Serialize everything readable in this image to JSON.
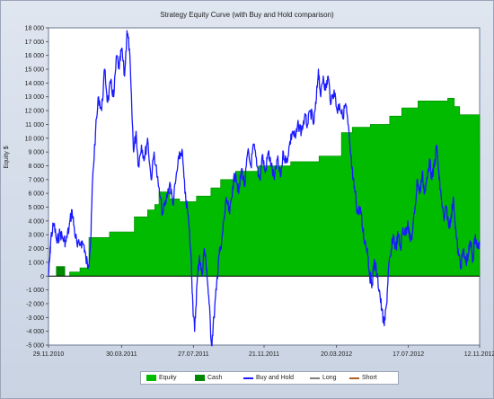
{
  "chart_data": {
    "type": "area",
    "title": "Strategy Equity Curve (with Buy and Hold comparison)",
    "ylabel": "Equity $",
    "ylim": [
      -5000,
      18000
    ],
    "yticks": [
      18000,
      17000,
      16000,
      15000,
      14000,
      13000,
      12000,
      11000,
      10000,
      9000,
      8000,
      7000,
      6000,
      5000,
      4000,
      3000,
      2000,
      1000,
      0,
      -1000,
      -2000,
      -3000,
      -4000,
      -5000
    ],
    "ytick_labels": [
      "18 000",
      "17 000",
      "16 000",
      "15 000",
      "14 000",
      "13 000",
      "12 000",
      "11 000",
      "10 000",
      "9 000",
      "8 000",
      "7 000",
      "6 000",
      "5 000",
      "4 000",
      "3 000",
      "2 000",
      "1 000",
      "0",
      "-1 000",
      "-2 000",
      "-3 000",
      "-4 000",
      "-5 000"
    ],
    "xlim": [
      "2010-11-29",
      "2012-11-12"
    ],
    "xticks": [
      "2010-11-29",
      "2011-03-30",
      "2011-07-27",
      "2011-11-21",
      "2012-03-20",
      "2012-07-17",
      "2012-11-12"
    ],
    "xtick_labels": [
      "29.11.2010",
      "30.03.2011",
      "27.07.2011",
      "21.11.2011",
      "20.03.2012",
      "17.07.2012",
      "12.11.2012"
    ],
    "grid": false,
    "legend_position": "bottom",
    "colors": {
      "equity": "#00bb00",
      "cash": "#008800",
      "buy_and_hold": "#1a1aff",
      "long": "#808080",
      "short": "#b06020",
      "zero_line": "#000000"
    },
    "series": [
      {
        "name": "Equity",
        "style": "step-area",
        "points": [
          [
            "2010-11-29",
            0
          ],
          [
            "2010-12-12",
            0
          ],
          [
            "2010-12-12",
            700
          ],
          [
            "2010-12-26",
            700
          ],
          [
            "2010-12-26",
            0
          ],
          [
            "2011-01-03",
            0
          ],
          [
            "2011-01-03",
            300
          ],
          [
            "2011-01-20",
            300
          ],
          [
            "2011-01-20",
            600
          ],
          [
            "2011-02-04",
            600
          ],
          [
            "2011-02-04",
            2800
          ],
          [
            "2011-03-10",
            2800
          ],
          [
            "2011-03-10",
            3200
          ],
          [
            "2011-04-20",
            3200
          ],
          [
            "2011-04-20",
            4300
          ],
          [
            "2011-05-12",
            4300
          ],
          [
            "2011-05-12",
            4800
          ],
          [
            "2011-05-24",
            4800
          ],
          [
            "2011-05-24",
            5200
          ],
          [
            "2011-05-31",
            5200
          ],
          [
            "2011-05-31",
            6100
          ],
          [
            "2011-06-18",
            6100
          ],
          [
            "2011-06-18",
            5600
          ],
          [
            "2011-07-04",
            5600
          ],
          [
            "2011-07-04",
            5400
          ],
          [
            "2011-08-01",
            5400
          ],
          [
            "2011-08-01",
            5800
          ],
          [
            "2011-08-25",
            5800
          ],
          [
            "2011-08-25",
            6400
          ],
          [
            "2011-09-10",
            6400
          ],
          [
            "2011-09-10",
            7000
          ],
          [
            "2011-10-05",
            7000
          ],
          [
            "2011-10-05",
            7600
          ],
          [
            "2011-11-12",
            7600
          ],
          [
            "2011-11-12",
            8000
          ],
          [
            "2012-01-04",
            8000
          ],
          [
            "2012-01-04",
            8300
          ],
          [
            "2012-02-20",
            8300
          ],
          [
            "2012-02-20",
            8700
          ],
          [
            "2012-03-28",
            8700
          ],
          [
            "2012-03-28",
            10400
          ],
          [
            "2012-04-15",
            10400
          ],
          [
            "2012-04-15",
            10800
          ],
          [
            "2012-05-15",
            10800
          ],
          [
            "2012-05-15",
            11000
          ],
          [
            "2012-06-16",
            11000
          ],
          [
            "2012-06-16",
            11600
          ],
          [
            "2012-07-06",
            11600
          ],
          [
            "2012-07-06",
            12200
          ],
          [
            "2012-08-02",
            12200
          ],
          [
            "2012-08-02",
            12700
          ],
          [
            "2012-09-20",
            12700
          ],
          [
            "2012-09-20",
            12900
          ],
          [
            "2012-10-01",
            12900
          ],
          [
            "2012-10-01",
            12300
          ],
          [
            "2012-10-10",
            12300
          ],
          [
            "2012-10-10",
            11700
          ],
          [
            "2012-11-12",
            11700
          ]
        ]
      },
      {
        "name": "Cash",
        "style": "step-area",
        "points": [
          [
            "2010-12-12",
            700
          ],
          [
            "2010-12-26",
            700
          ]
        ]
      },
      {
        "name": "Buy and Hold",
        "style": "line",
        "points": [
          [
            "2010-11-29",
            0
          ],
          [
            "2010-12-01",
            1200
          ],
          [
            "2010-12-03",
            2800
          ],
          [
            "2010-12-08",
            3800
          ],
          [
            "2010-12-13",
            2400
          ],
          [
            "2010-12-18",
            3200
          ],
          [
            "2010-12-23",
            2700
          ],
          [
            "2010-12-28",
            2500
          ],
          [
            "2011-01-02",
            3500
          ],
          [
            "2011-01-07",
            4800
          ],
          [
            "2011-01-11",
            3300
          ],
          [
            "2011-01-16",
            2100
          ],
          [
            "2011-01-22",
            2500
          ],
          [
            "2011-01-27",
            2200
          ],
          [
            "2011-01-30",
            1200
          ],
          [
            "2011-02-03",
            800
          ],
          [
            "2011-02-07",
            2600
          ],
          [
            "2011-02-10",
            7000
          ],
          [
            "2011-02-15",
            10500
          ],
          [
            "2011-02-20",
            13000
          ],
          [
            "2011-02-25",
            12000
          ],
          [
            "2011-03-02",
            15000
          ],
          [
            "2011-03-07",
            12600
          ],
          [
            "2011-03-12",
            14000
          ],
          [
            "2011-03-17",
            13000
          ],
          [
            "2011-03-22",
            16000
          ],
          [
            "2011-03-26",
            15000
          ],
          [
            "2011-03-30",
            16500
          ],
          [
            "2011-04-04",
            14500
          ],
          [
            "2011-04-08",
            17800
          ],
          [
            "2011-04-12",
            16500
          ],
          [
            "2011-04-16",
            12000
          ],
          [
            "2011-04-19",
            9000
          ],
          [
            "2011-04-23",
            10500
          ],
          [
            "2011-04-27",
            8000
          ],
          [
            "2011-05-02",
            9500
          ],
          [
            "2011-05-07",
            8500
          ],
          [
            "2011-05-12",
            10000
          ],
          [
            "2011-05-18",
            7000
          ],
          [
            "2011-05-23",
            9000
          ],
          [
            "2011-05-30",
            6500
          ],
          [
            "2011-06-06",
            4500
          ],
          [
            "2011-06-12",
            5500
          ],
          [
            "2011-06-18",
            6800
          ],
          [
            "2011-06-23",
            5200
          ],
          [
            "2011-06-28",
            7000
          ],
          [
            "2011-07-03",
            8500
          ],
          [
            "2011-07-08",
            9200
          ],
          [
            "2011-07-13",
            6000
          ],
          [
            "2011-07-18",
            4500
          ],
          [
            "2011-07-23",
            1500
          ],
          [
            "2011-07-26",
            -2000
          ],
          [
            "2011-07-29",
            -4000
          ],
          [
            "2011-08-02",
            -500
          ],
          [
            "2011-08-06",
            1500
          ],
          [
            "2011-08-10",
            0
          ],
          [
            "2011-08-14",
            2000
          ],
          [
            "2011-08-18",
            500
          ],
          [
            "2011-08-22",
            -2000
          ],
          [
            "2011-08-26",
            -5000
          ],
          [
            "2011-08-30",
            -3000
          ],
          [
            "2011-09-03",
            -1000
          ],
          [
            "2011-09-07",
            1500
          ],
          [
            "2011-09-11",
            2000
          ],
          [
            "2011-09-15",
            4000
          ],
          [
            "2011-09-20",
            5500
          ],
          [
            "2011-09-25",
            4500
          ],
          [
            "2011-09-30",
            6500
          ],
          [
            "2011-10-05",
            7500
          ],
          [
            "2011-10-10",
            6000
          ],
          [
            "2011-10-15",
            7800
          ],
          [
            "2011-10-20",
            6500
          ],
          [
            "2011-10-25",
            9000
          ],
          [
            "2011-10-30",
            8000
          ],
          [
            "2011-11-04",
            9500
          ],
          [
            "2011-11-09",
            8000
          ],
          [
            "2011-11-14",
            7000
          ],
          [
            "2011-11-18",
            8800
          ],
          [
            "2011-11-23",
            7500
          ],
          [
            "2011-11-28",
            9000
          ],
          [
            "2011-12-03",
            8000
          ],
          [
            "2011-12-08",
            7000
          ],
          [
            "2011-12-13",
            8500
          ],
          [
            "2011-12-18",
            7200
          ],
          [
            "2011-12-23",
            9000
          ],
          [
            "2011-12-28",
            8200
          ],
          [
            "2012-01-02",
            9500
          ],
          [
            "2012-01-07",
            10500
          ],
          [
            "2012-01-12",
            10000
          ],
          [
            "2012-01-17",
            11000
          ],
          [
            "2012-01-22",
            10500
          ],
          [
            "2012-01-27",
            11500
          ],
          [
            "2012-02-01",
            11000
          ],
          [
            "2012-02-06",
            12000
          ],
          [
            "2012-02-11",
            11000
          ],
          [
            "2012-02-15",
            12500
          ],
          [
            "2012-02-19",
            15000
          ],
          [
            "2012-02-23",
            13000
          ],
          [
            "2012-02-27",
            14500
          ],
          [
            "2012-03-02",
            13500
          ],
          [
            "2012-03-06",
            14500
          ],
          [
            "2012-03-11",
            12500
          ],
          [
            "2012-03-16",
            13500
          ],
          [
            "2012-03-21",
            12000
          ],
          [
            "2012-03-25",
            12500
          ],
          [
            "2012-03-30",
            11500
          ],
          [
            "2012-04-04",
            12500
          ],
          [
            "2012-04-08",
            11000
          ],
          [
            "2012-04-12",
            9000
          ],
          [
            "2012-04-16",
            7000
          ],
          [
            "2012-04-20",
            6000
          ],
          [
            "2012-04-24",
            4500
          ],
          [
            "2012-04-28",
            5000
          ],
          [
            "2012-05-02",
            3500
          ],
          [
            "2012-05-06",
            2500
          ],
          [
            "2012-05-10",
            2000
          ],
          [
            "2012-05-14",
            0
          ],
          [
            "2012-05-18",
            -500
          ],
          [
            "2012-05-22",
            1200
          ],
          [
            "2012-05-26",
            0
          ],
          [
            "2012-05-30",
            -1000
          ],
          [
            "2012-06-03",
            -2500
          ],
          [
            "2012-06-07",
            -3600
          ],
          [
            "2012-06-11",
            -2000
          ],
          [
            "2012-06-14",
            500
          ],
          [
            "2012-06-18",
            1500
          ],
          [
            "2012-06-22",
            3000
          ],
          [
            "2012-06-26",
            2000
          ],
          [
            "2012-06-30",
            3000
          ],
          [
            "2012-07-04",
            2000
          ],
          [
            "2012-07-08",
            3500
          ],
          [
            "2012-07-12",
            3000
          ],
          [
            "2012-07-16",
            4000
          ],
          [
            "2012-07-20",
            2500
          ],
          [
            "2012-07-24",
            3200
          ],
          [
            "2012-07-28",
            5000
          ],
          [
            "2012-08-01",
            7000
          ],
          [
            "2012-08-05",
            6000
          ],
          [
            "2012-08-09",
            7500
          ],
          [
            "2012-08-13",
            6000
          ],
          [
            "2012-08-17",
            7000
          ],
          [
            "2012-08-21",
            8500
          ],
          [
            "2012-08-25",
            7000
          ],
          [
            "2012-08-29",
            8000
          ],
          [
            "2012-09-02",
            9500
          ],
          [
            "2012-09-06",
            7000
          ],
          [
            "2012-09-10",
            5500
          ],
          [
            "2012-09-14",
            4000
          ],
          [
            "2012-09-18",
            5000
          ],
          [
            "2012-09-22",
            3500
          ],
          [
            "2012-09-26",
            4500
          ],
          [
            "2012-09-30",
            5500
          ],
          [
            "2012-10-04",
            3000
          ],
          [
            "2012-10-08",
            1500
          ],
          [
            "2012-10-12",
            800
          ],
          [
            "2012-10-16",
            1800
          ],
          [
            "2012-10-20",
            1000
          ],
          [
            "2012-10-24",
            1500
          ],
          [
            "2012-10-28",
            2500
          ],
          [
            "2012-11-01",
            1200
          ],
          [
            "2012-11-05",
            3000
          ],
          [
            "2012-11-09",
            2000
          ],
          [
            "2012-11-12",
            2500
          ]
        ]
      }
    ],
    "legend": [
      {
        "label": "Equity",
        "kind": "box",
        "color": "#00bb00"
      },
      {
        "label": "Cash",
        "kind": "box",
        "color": "#008800"
      },
      {
        "label": "Buy and Hold",
        "kind": "line",
        "color": "#1a1aff"
      },
      {
        "label": "Long",
        "kind": "line",
        "color": "#808080"
      },
      {
        "label": "Short",
        "kind": "line",
        "color": "#b06020"
      }
    ]
  }
}
